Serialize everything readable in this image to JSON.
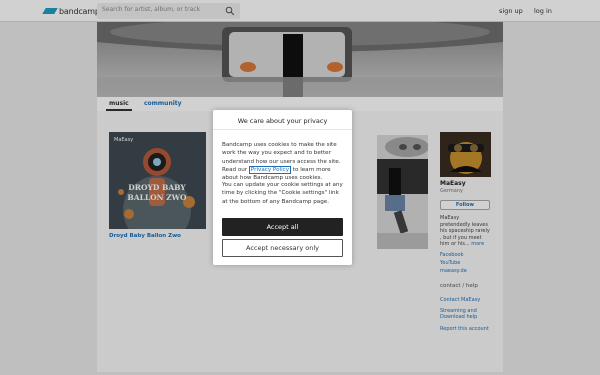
{
  "header": {
    "logo_text": "bandcamp",
    "search_placeholder": "Search for artist, album, or track",
    "signup_label": "sign up",
    "login_label": "log in"
  },
  "tabs": [
    {
      "label": "music"
    },
    {
      "label": "community"
    }
  ],
  "album": {
    "title": "Droyd Baby Ballon Zwo",
    "art_badge": "MaEasy",
    "art_line1": "DROYD BABY",
    "art_line2": "BALLON ZWO"
  },
  "artist": {
    "name": "MaEasy",
    "location": "Germany",
    "follow_label": "Follow",
    "bio_line1": "MaEasy",
    "bio_line2": "pretendedly leaves",
    "bio_line3": "his spaceship rarely",
    "bio_line4": ", but if you meet",
    "bio_line5": "him or his...",
    "more_label": "more",
    "links": [
      "Facebook",
      "YouTube",
      "maeasy.de"
    ],
    "contact_heading": "contact / help",
    "contact_link": "Contact MaEasy",
    "help_line1": "Streaming and",
    "help_line2": "Download help",
    "report_label": "Report this account"
  },
  "modal": {
    "title": "We care about your privacy",
    "p1_before": "Bandcamp uses cookies to make the site work the way you better understand how our users access the site. Read our",
    "p1_before_full": "Bandcamp uses cookies to make the site work the way you expect and to better understand how our users access the site. Read our",
    "policy_link": "Privacy Policy",
    "p1_after": "to learn more about how Bandcamp uses cookies.",
    "p2": "You can update your cookie settings at any time by clicking the \"Cookie settings\" link at the bottom of any Bandcamp page.",
    "accept_all_label": "Accept all",
    "accept_necessary_label": "Accept necessary only"
  },
  "colors": {
    "brand_blue": "#1da0c3",
    "link_blue": "#1d70b8",
    "dark_button": "#222222"
  }
}
